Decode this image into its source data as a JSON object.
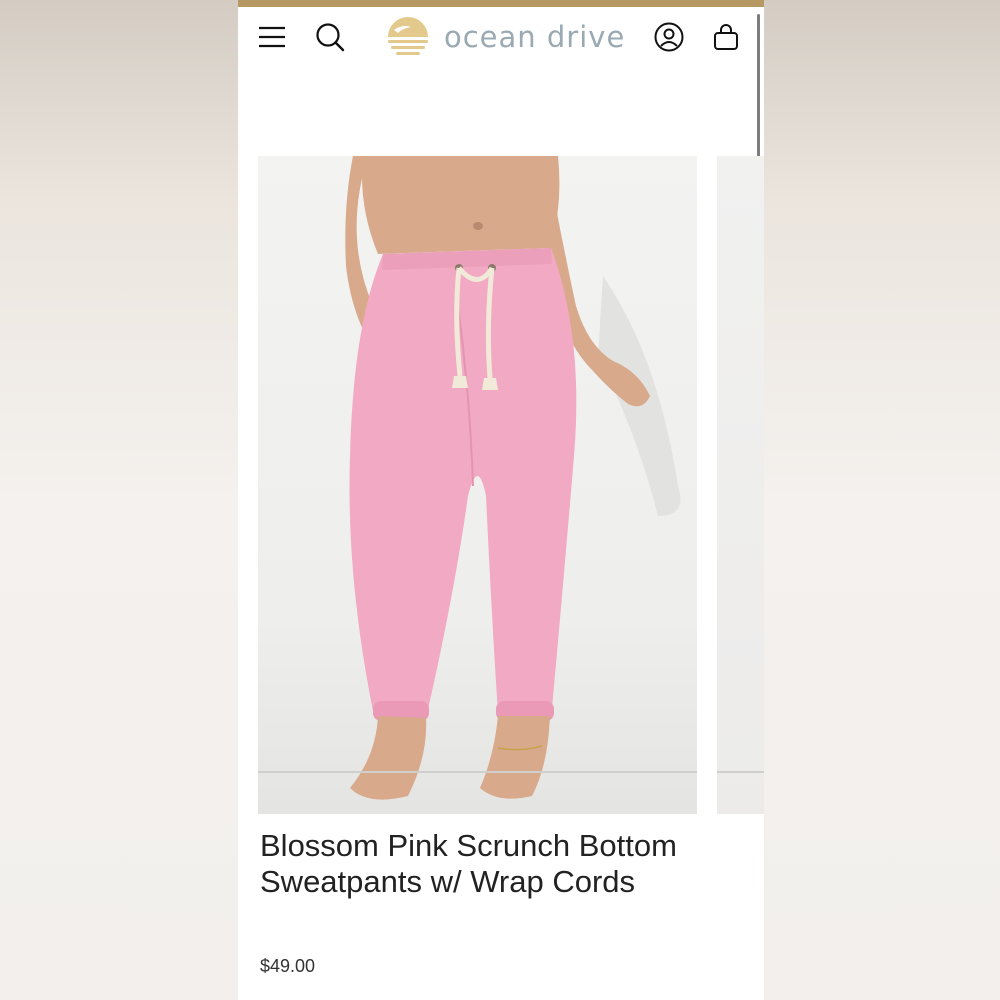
{
  "brand": {
    "name": "ocean drive"
  },
  "header": {
    "menu_icon": "menu-icon",
    "search_icon": "search-icon",
    "account_icon": "account-icon",
    "cart_icon": "cart-icon"
  },
  "product": {
    "title": "Blossom Pink Scrunch Bottom Sweatpants w/ Wrap Cords",
    "price": "$49.00",
    "images": [
      {
        "description_icon": "product-photo"
      },
      {
        "description_icon": "product-photo-next"
      }
    ]
  },
  "colors": {
    "accent_strip": "#b69862",
    "logo_gold": "#e3c98b",
    "logo_text": "#9aa9b2",
    "pants_pink": "#f2a9c3"
  }
}
